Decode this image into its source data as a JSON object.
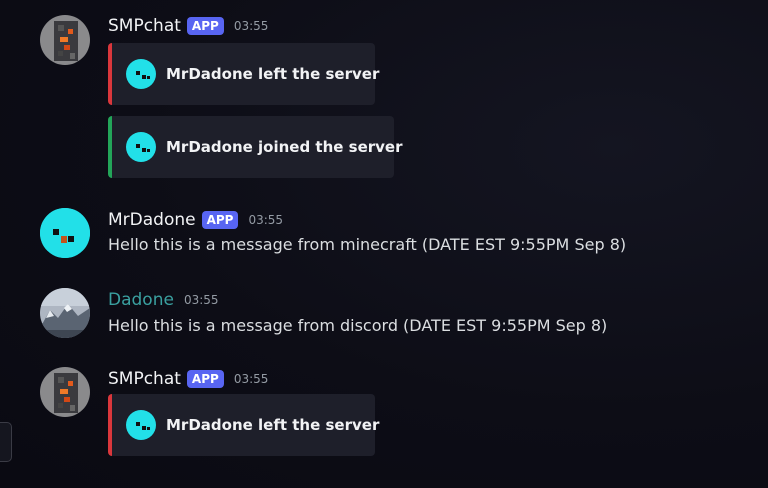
{
  "messages": [
    {
      "username": "SMPchat",
      "badge": "APP",
      "time": "03:55",
      "embeds": [
        {
          "text": "MrDadone left the server",
          "status": "red"
        },
        {
          "text": "MrDadone joined the server",
          "status": "green"
        }
      ]
    },
    {
      "username": "MrDadone",
      "badge": "APP",
      "time": "03:55",
      "content": "Hello this is a message from minecraft (DATE EST 9:55PM Sep 8)"
    },
    {
      "username": "Dadone",
      "time": "03:55",
      "content": "Hello this is a message from discord (DATE EST 9:55PM Sep 8)"
    },
    {
      "username": "SMPchat",
      "badge": "APP",
      "time": "03:55",
      "embeds": [
        {
          "text": "MrDadone left the server",
          "status": "red"
        }
      ]
    }
  ],
  "colors": {
    "badge": "#5865f2",
    "embed_left": "#da373c",
    "embed_join": "#23a559",
    "skin_cyan": "#22e0e8",
    "dadone_name": "#3aa0a0"
  },
  "icons": [
    "minecraft-skin-icon",
    "rock-avatar-icon",
    "mountain-avatar-icon"
  ]
}
